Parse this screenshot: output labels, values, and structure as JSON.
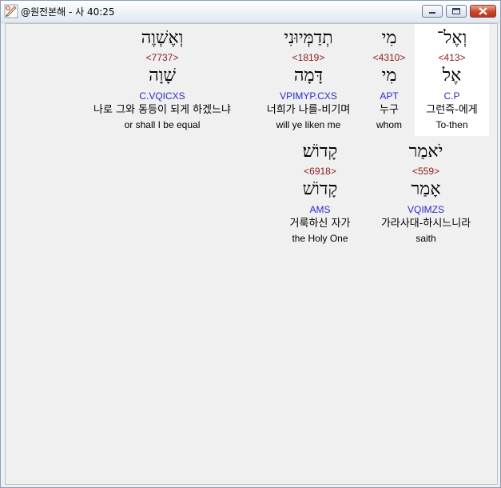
{
  "window": {
    "title": "@원전본해 - 사 40:25",
    "icons": {
      "app": "interlinear-app-icon",
      "minimize": "minimize-icon",
      "maximize": "maximize-icon",
      "close": "close-icon"
    },
    "colors": {
      "strong_number": "#8b1a1a",
      "morphology": "#2a2ad0",
      "highlight": "#ffffff",
      "background": "#f0f0f0"
    }
  },
  "words": [
    {
      "hebrew": "וְאֶל־",
      "strong": "<413>",
      "lemma": "אֶל",
      "morph": "C.P",
      "korean": "그런즉-에게",
      "english": "To-then",
      "highlighted": true
    },
    {
      "hebrew": "מִי",
      "strong": "<4310>",
      "lemma": "מִי",
      "morph": "APT",
      "korean": "누구",
      "english": "whom",
      "highlighted": false
    },
    {
      "hebrew": "תְדַמְּיוּנִי",
      "strong": "<1819>",
      "lemma": "דָּמָה",
      "morph": "VPIMYP.CXS",
      "korean": "너희가 나를-비기며",
      "english": "will ye liken me",
      "highlighted": false
    },
    {
      "hebrew": "וְאֶשְׁוֶה",
      "strong": "<7737>",
      "lemma": "שָׁוָה",
      "morph": "C.VQICXS",
      "korean": "나로 그와 동등이 되게 하겠느냐",
      "english": "or shall I be equal",
      "highlighted": false
    },
    {
      "hebrew": "יֹאמַר",
      "strong": "<559>",
      "lemma": "אָמַר",
      "morph": "VQIMZS",
      "korean": "가라사대-하시느니라",
      "english": "saith",
      "highlighted": false
    },
    {
      "hebrew": "קָדוֹשׁ׃",
      "strong": "<6918>",
      "lemma": "קָדוֹשׁ",
      "morph": "AMS",
      "korean": "거룩하신 자가",
      "english": "the Holy One",
      "highlighted": false
    }
  ]
}
